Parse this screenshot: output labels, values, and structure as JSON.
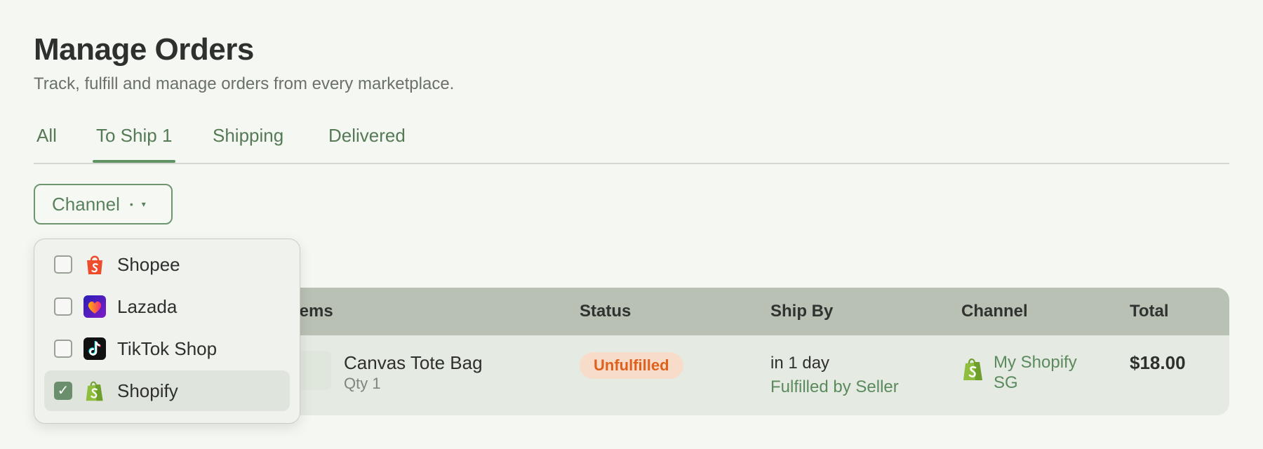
{
  "header": {
    "title": "Manage Orders",
    "subtitle": "Track, fulfill and manage orders from every marketplace."
  },
  "tabs": [
    {
      "label": "All"
    },
    {
      "label": "To Ship 1",
      "active": true
    },
    {
      "label": "Shipping"
    },
    {
      "label": "Delivered"
    }
  ],
  "filter": {
    "label": "Channel",
    "dot": "•",
    "chevron": "▾"
  },
  "dropdown": {
    "options": [
      {
        "label": "Shopee",
        "checked": false,
        "icon": "shopee-icon"
      },
      {
        "label": "Lazada",
        "checked": false,
        "icon": "lazada-icon"
      },
      {
        "label": "TikTok Shop",
        "checked": false,
        "icon": "tiktok-icon"
      },
      {
        "label": "Shopify",
        "checked": true,
        "icon": "shopify-icon"
      }
    ],
    "check_mark": "✓"
  },
  "table": {
    "columns": [
      "Items",
      "Status",
      "Ship By",
      "Channel",
      "Total"
    ],
    "rows": [
      {
        "item_name": "Canvas Tote Bag",
        "item_qty": "Qty 1",
        "status": "Unfulfilled",
        "ship_by": "in 1 day",
        "fulfillment": "Fulfilled by Seller",
        "channel": "My Shopify SG",
        "channel_icon": "shopify-icon",
        "total": "$18.00"
      }
    ]
  },
  "colors": {
    "accent": "#5f9262",
    "status_unfulfilled": "#e0601e",
    "status_unfulfilled_bg": "#f7ddc9",
    "table_header_bg": "#b9c0b4",
    "page_bg": "#f5f7f3"
  }
}
